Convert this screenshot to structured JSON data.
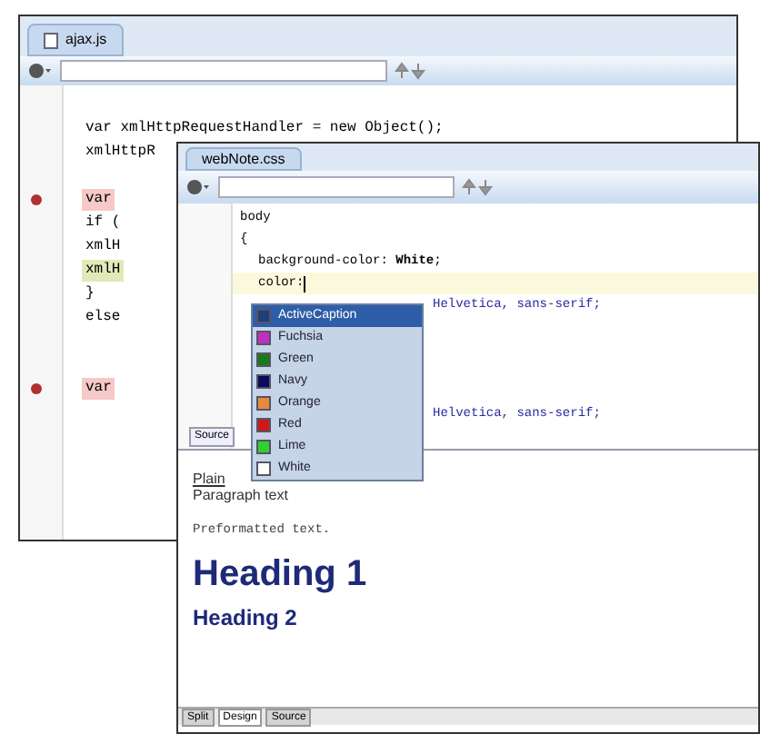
{
  "back_window": {
    "tab": "ajax.js",
    "lines": [
      {
        "kind": "blank"
      },
      {
        "text": "var xmlHttpRequestHandler = new Object();",
        "kind": "plain"
      },
      {
        "text": "xmlHttpR",
        "kind": "plain"
      },
      {
        "kind": "blank"
      },
      {
        "text": "var",
        "kind": "breakpoint"
      },
      {
        "text": "if (",
        "kind": "plain"
      },
      {
        "text": "xmlH",
        "kind": "plain"
      },
      {
        "text": "xmlH",
        "kind": "current"
      },
      {
        "text": "}",
        "kind": "plain"
      },
      {
        "text": "else",
        "kind": "plain"
      },
      {
        "kind": "blank"
      },
      {
        "kind": "blank"
      },
      {
        "text": "var",
        "kind": "breakpoint"
      }
    ]
  },
  "front_window": {
    "tab": "webNote.css",
    "lines": [
      {
        "text": "body",
        "kind": "plain"
      },
      {
        "text": "{",
        "kind": "plain"
      },
      {
        "text": "background-color: **White**;",
        "kind": "plain"
      },
      {
        "text": "color: ",
        "kind": "caret"
      },
      {
        "text": "Helvetica, sans-serif;",
        "kind": "tail"
      },
      {
        "kind": "blank"
      },
      {
        "kind": "blank"
      },
      {
        "kind": "blank"
      },
      {
        "kind": "blank"
      },
      {
        "text": "Helvetica, sans-serif;",
        "kind": "tail"
      }
    ],
    "completions": [
      {
        "label": "ActiveCaption",
        "color": "#1f3f7a",
        "selected": true
      },
      {
        "label": "Fuchsia",
        "color": "#c030c0",
        "selected": false
      },
      {
        "label": "Green",
        "color": "#1a7a1a",
        "selected": false
      },
      {
        "label": "Navy",
        "color": "#0a0a60",
        "selected": false
      },
      {
        "label": "Orange",
        "color": "#e88a3a",
        "selected": false
      },
      {
        "label": "Red",
        "color": "#d01818",
        "selected": false
      },
      {
        "label": "Lime",
        "color": "#30d030",
        "selected": false
      },
      {
        "label": "White",
        "color": "#ffffff",
        "selected": false
      }
    ],
    "split_tab": "Source",
    "link": "Plain",
    "preview": [
      {
        "text": "Paragraph text",
        "kind": "p"
      },
      {
        "text": "Preformatted text.",
        "kind": "pre"
      },
      {
        "text": "Heading 1",
        "kind": "h1"
      },
      {
        "text": "Heading 2",
        "kind": "h2"
      }
    ],
    "bottom_tabs": [
      {
        "label": "Split",
        "selected": false
      },
      {
        "label": "Design",
        "selected": true
      },
      {
        "label": "Source",
        "selected": false
      }
    ]
  }
}
